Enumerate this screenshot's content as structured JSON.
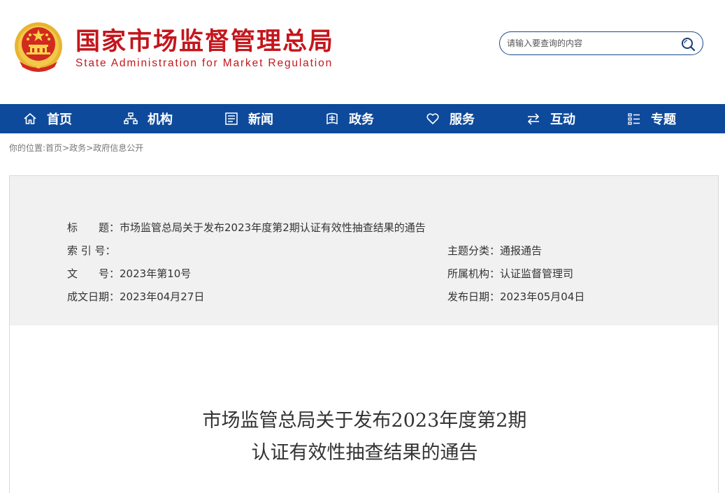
{
  "header": {
    "title_cn": "国家市场监督管理总局",
    "title_en": "State Administration for Market Regulation",
    "search_placeholder": "请输入要查询的内容"
  },
  "nav": {
    "items": [
      {
        "label": "首页",
        "icon": "home-icon"
      },
      {
        "label": "机构",
        "icon": "org-icon"
      },
      {
        "label": "新闻",
        "icon": "news-icon"
      },
      {
        "label": "政务",
        "icon": "affairs-icon"
      },
      {
        "label": "服务",
        "icon": "heart-icon"
      },
      {
        "label": "互动",
        "icon": "exchange-icon"
      },
      {
        "label": "专题",
        "icon": "topic-icon"
      }
    ]
  },
  "breadcrumb": {
    "prefix": "你的位置:",
    "items": [
      "首页",
      "政务",
      "政府信息公开"
    ],
    "separator": ">"
  },
  "info": {
    "title_label": "标　　题：",
    "title_value": "市场监管总局关于发布2023年度第2期认证有效性抽查结果的通告",
    "index_label": "索 引 号：",
    "index_value": "",
    "doc_no_label": "文　　号：",
    "doc_no_value": "2023年第10号",
    "date_written_label": "成文日期：",
    "date_written_value": "2023年04月27日",
    "category_label": "主题分类：",
    "category_value": "通报通告",
    "agency_label": "所属机构：",
    "agency_value": "认证监督管理司",
    "publish_label": "发布日期：",
    "publish_value": "2023年05月04日"
  },
  "article": {
    "title_line1": "市场监管总局关于发布2023年度第2期",
    "title_line2": "认证有效性抽查结果的通告"
  },
  "colors": {
    "brand_red": "#c4161c",
    "nav_blue": "#0e4a9b",
    "panel_gray": "#f1f1f1"
  }
}
